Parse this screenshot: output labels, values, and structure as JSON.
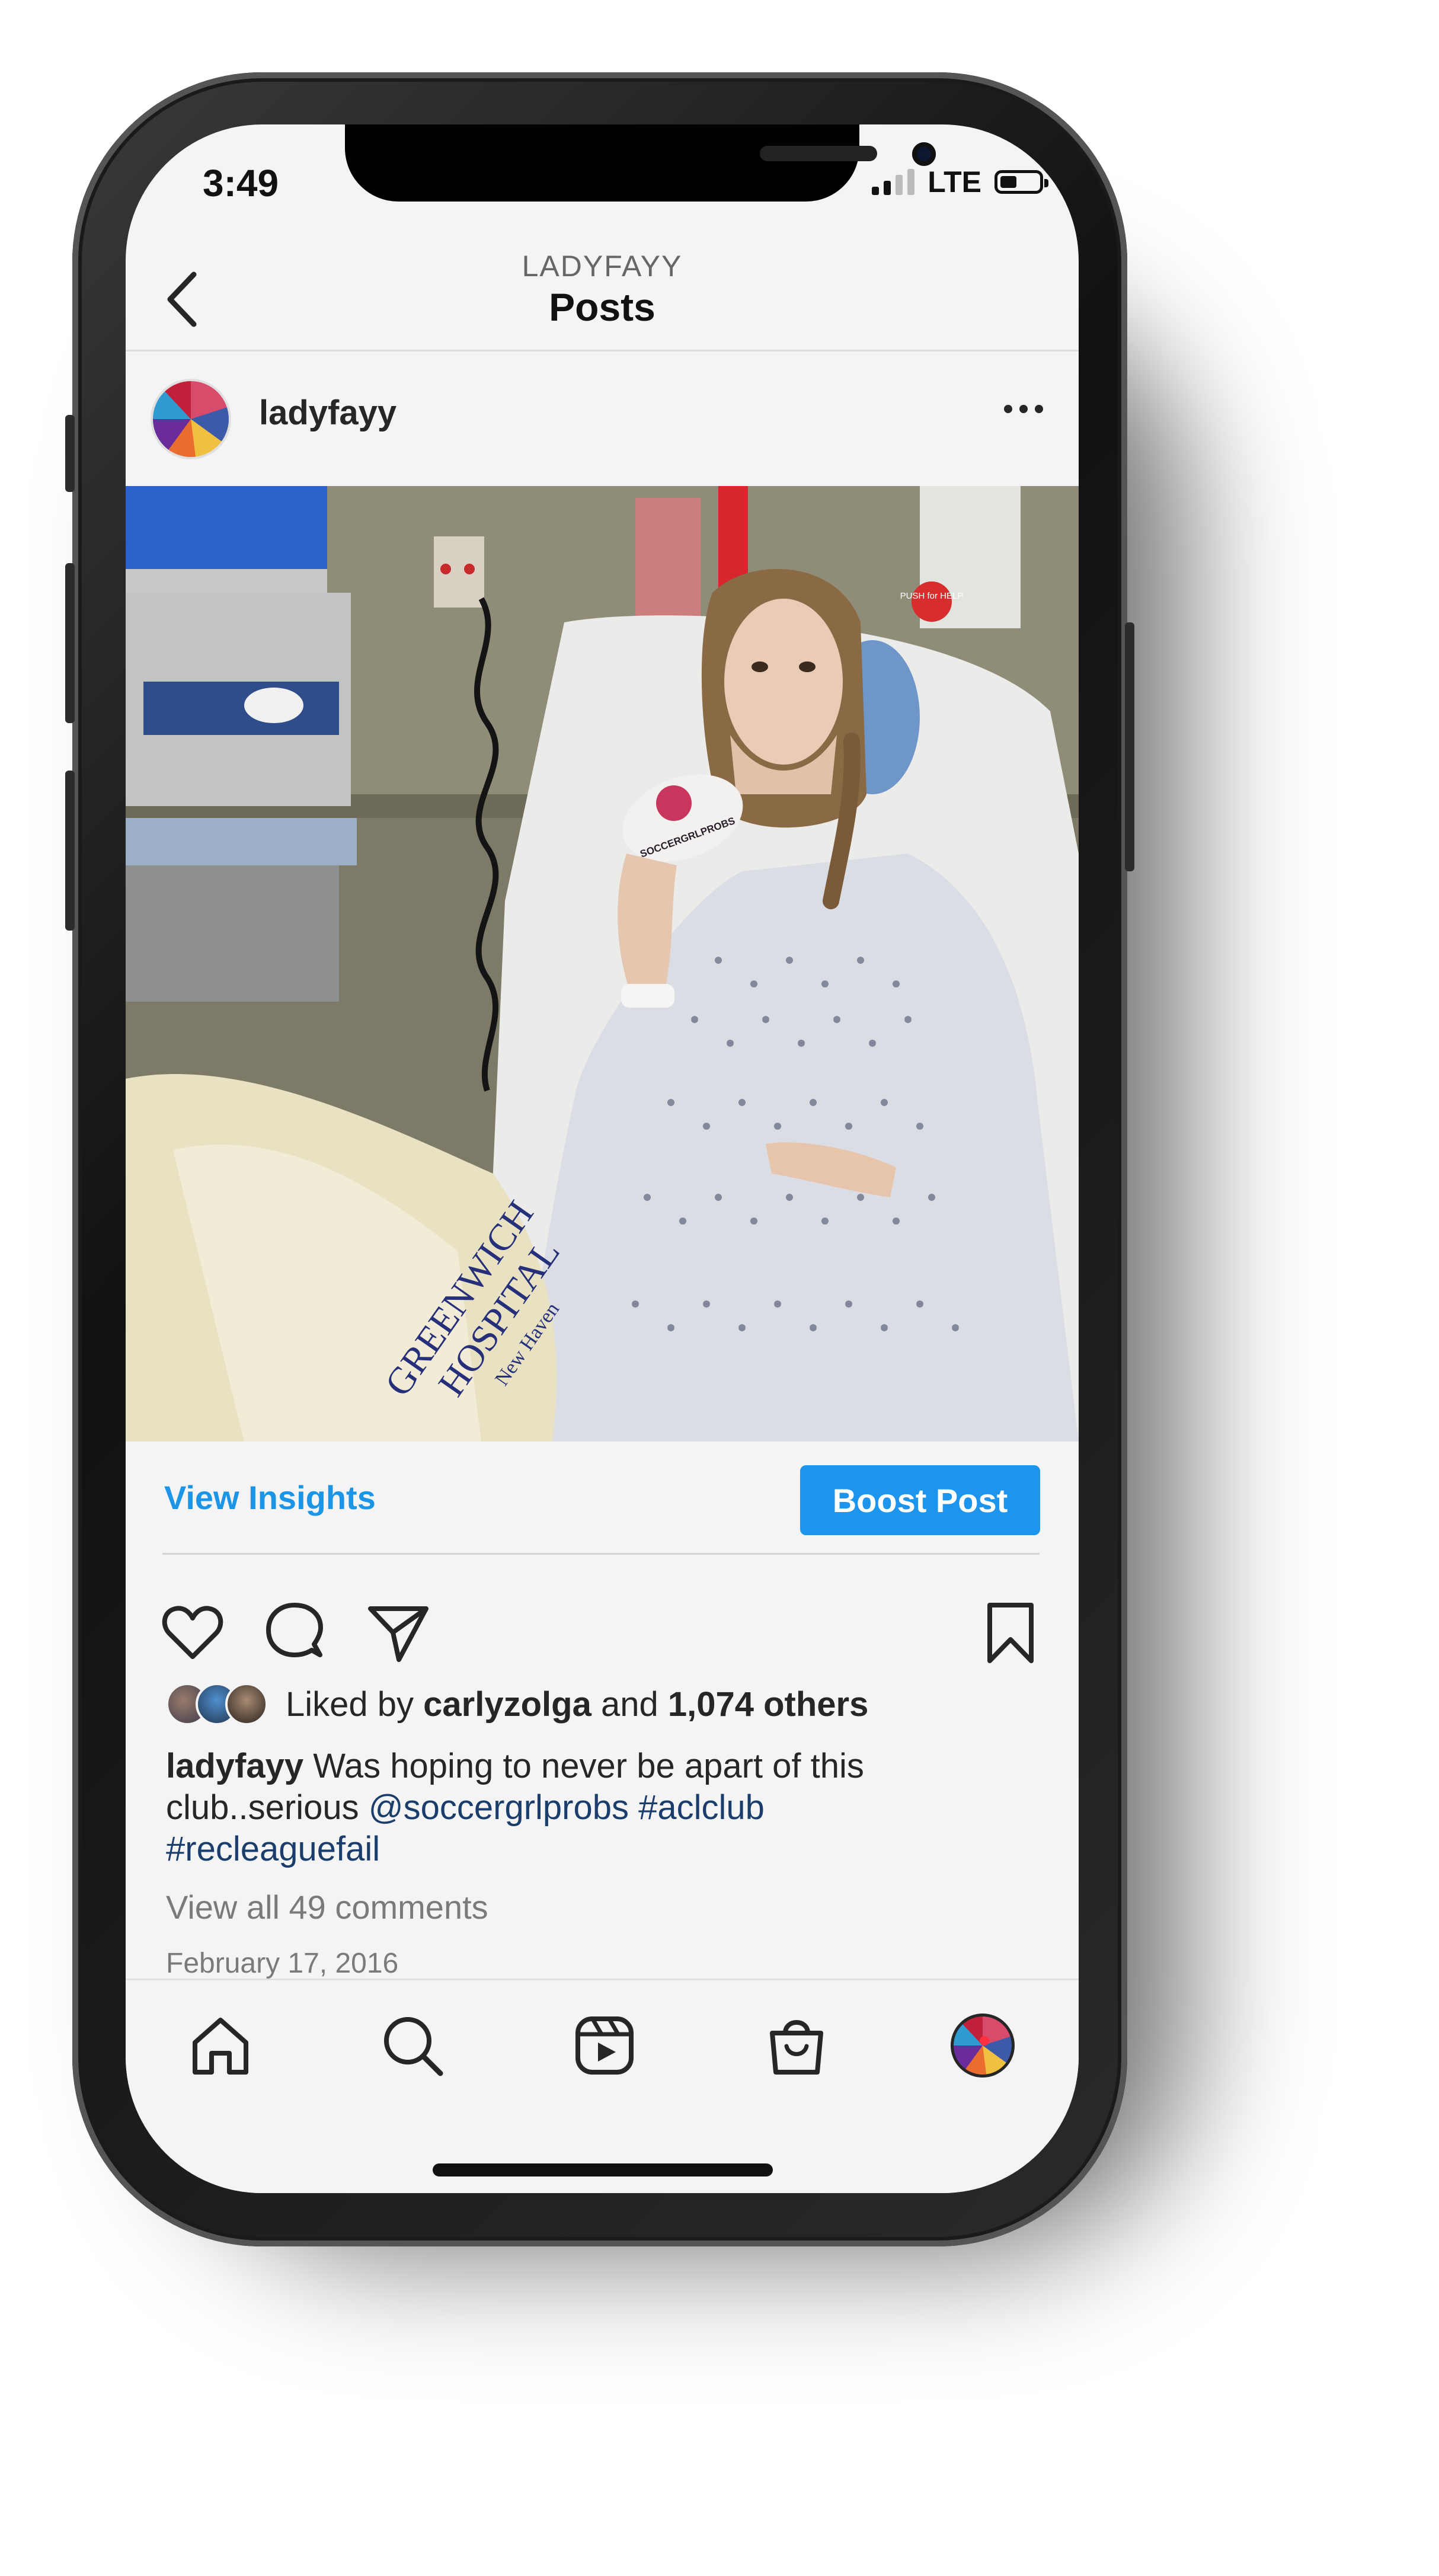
{
  "status": {
    "time": "3:49",
    "network": "LTE"
  },
  "nav": {
    "subtitle": "LADYFAYY",
    "title": "Posts"
  },
  "post": {
    "username": "ladyfayy",
    "insights_label": "View Insights",
    "boost_label": "Boost Post",
    "liked": {
      "prefix": "Liked by",
      "user": "carlyzolga",
      "connector": "and",
      "others": "1,074 others"
    },
    "caption": {
      "username": "ladyfayy",
      "text": "Was hoping to never be apart of this club..serious",
      "mention": "@soccergrlprobs",
      "hashtag1": "#aclclub",
      "hashtag2": "#recleaguefail"
    },
    "comments_label": "View all 49 comments",
    "date": "February 17, 2016",
    "photo_text": {
      "sign": "PUSH for HELP",
      "bag_line1": "GREENWICH",
      "bag_line2": "HOSPITAL",
      "bag_line3": "New Haven",
      "card": "SOCCERGRLPROBS"
    }
  },
  "icons": {
    "back": "chevron-left-icon",
    "more": "more-icon",
    "like": "heart-icon",
    "comment": "comment-icon",
    "share": "paper-plane-icon",
    "save": "bookmark-icon",
    "home": "home-icon",
    "search": "search-icon",
    "reels": "reels-icon",
    "shop": "shop-bag-icon",
    "profile": "profile-avatar"
  },
  "colors": {
    "accent": "#1d95e6",
    "boost_bg": "#1e95ec",
    "hashtag": "#1a3d6b",
    "notification_dot": "#ff3040"
  }
}
